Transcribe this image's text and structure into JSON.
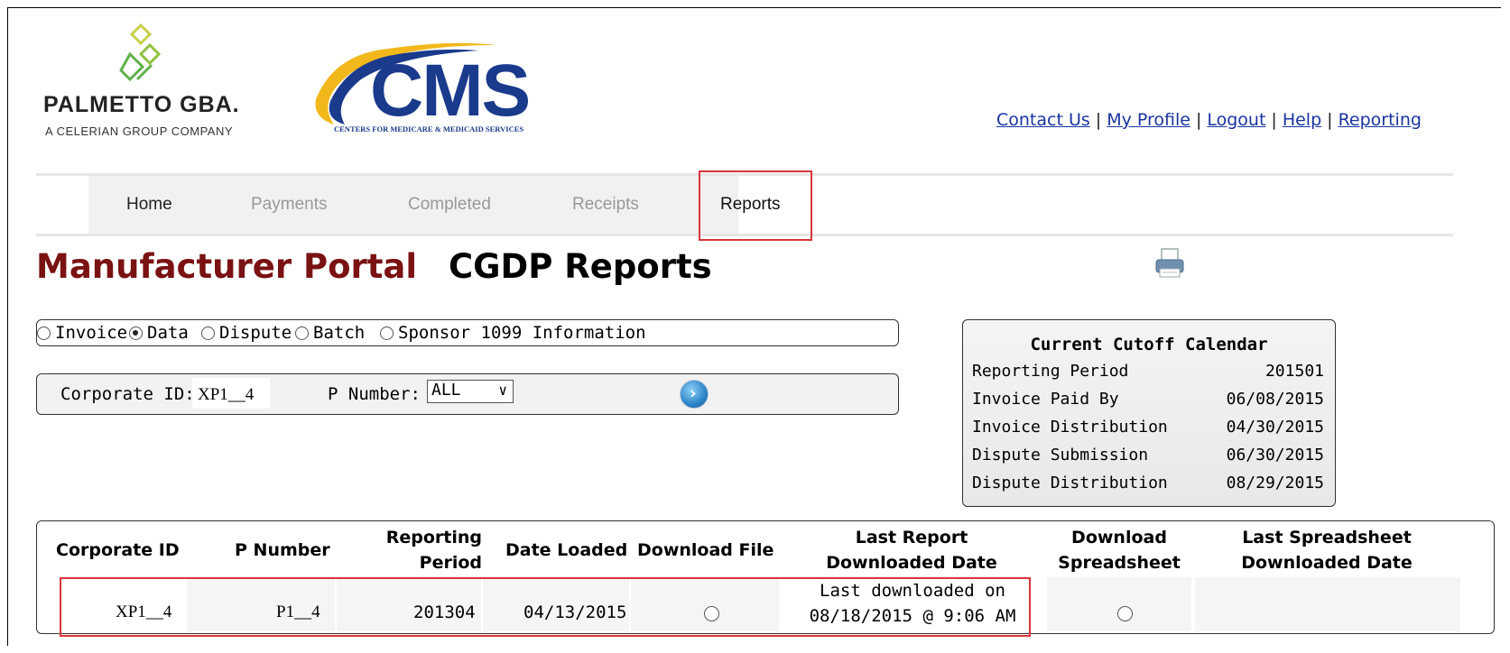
{
  "branding": {
    "palmetto_name": "PALMETTO GBA.",
    "palmetto_tagline": "A CELERIAN GROUP COMPANY",
    "cms_logo": "CMS",
    "cms_tagline": "CENTERS FOR MEDICARE & MEDICAID SERVICES"
  },
  "top_links": [
    "Contact Us",
    "My Profile",
    "Logout",
    "Help",
    "Reporting"
  ],
  "top_links_separator": "|",
  "nav": {
    "home": "Home",
    "payments": "Payments",
    "completed": "Completed",
    "receipts": "Receipts",
    "reports": "Reports",
    "active": "Reports"
  },
  "portal_title": "Manufacturer Portal",
  "page_title": "CGDP Reports",
  "print_icon": "printer-icon",
  "report_types": {
    "options": [
      "Invoice",
      "Data",
      "Dispute",
      "Batch",
      "Sponsor 1099 Information"
    ],
    "selected": "Data"
  },
  "filters": {
    "corporate_id_label": "Corporate ID:",
    "corporate_id_value": "XP1__4",
    "p_number_label": "P Number:",
    "p_number_value": "ALL",
    "go_icon": "arrow-right-circle-icon"
  },
  "cutoff_calendar": {
    "title": "Current Cutoff Calendar",
    "rows": [
      {
        "label": "Reporting Period",
        "value": "201501"
      },
      {
        "label": "Invoice Paid By",
        "value": "06/08/2015"
      },
      {
        "label": "Invoice Distribution",
        "value": "04/30/2015"
      },
      {
        "label": "Dispute Submission",
        "value": "06/30/2015"
      },
      {
        "label": "Dispute Distribution",
        "value": "08/29/2015"
      }
    ]
  },
  "table": {
    "headers": {
      "corporate_id": "Corporate ID",
      "p_number": "P Number",
      "reporting_period_1": "Reporting",
      "reporting_period_2": "Period",
      "date_loaded": "Date Loaded",
      "download_file": "Download File",
      "last_report_1": "Last Report",
      "last_report_2": "Downloaded Date",
      "download_spreadsheet_1": "Download",
      "download_spreadsheet_2": "Spreadsheet",
      "last_spreadsheet_1": "Last Spreadsheet",
      "last_spreadsheet_2": "Downloaded Date"
    },
    "row": {
      "corporate_id": "XP1__4",
      "p_number": "P1__4",
      "reporting_period": "201304",
      "date_loaded": "04/13/2015",
      "last_report_1": "Last downloaded on",
      "last_report_2": "08/18/2015 @ 9:06 AM"
    }
  },
  "colors": {
    "portal_title": "#7a1212",
    "highlight_box": "#d9353b",
    "link": "#1a34a0",
    "cms_blue": "#1a3a8c",
    "cms_arc_gold": "#f2b81b"
  }
}
